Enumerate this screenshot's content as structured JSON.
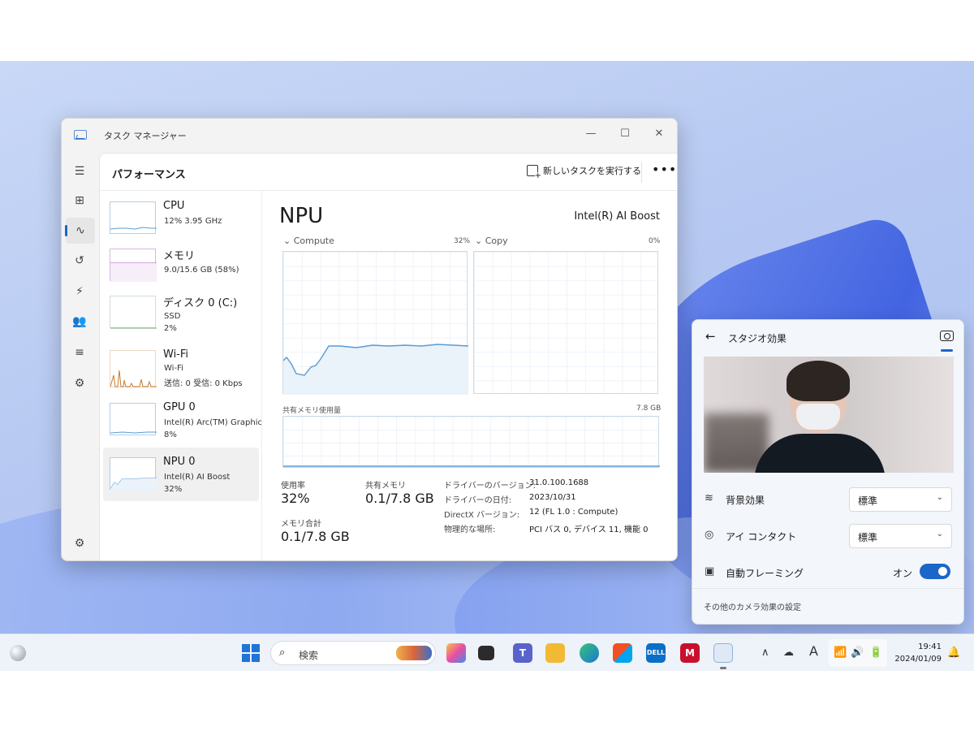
{
  "task_manager": {
    "title": "タスク マネージャー",
    "page_title": "パフォーマンス",
    "run_new_task": "新しいタスクを実行する",
    "more": "•••",
    "window": {
      "minimize": "—",
      "maximize": "☐",
      "close": "✕"
    },
    "devices": [
      {
        "name": "CPU",
        "line1": "12%  3.95 GHz",
        "line2": "",
        "line3": ""
      },
      {
        "name": "メモリ",
        "line1": "9.0/15.6 GB (58%)",
        "line2": "",
        "line3": ""
      },
      {
        "name": "ディスク 0 (C:)",
        "line1": "SSD",
        "line2": "2%",
        "line3": ""
      },
      {
        "name": "Wi-Fi",
        "line1": "Wi-Fi",
        "line2": "送信: 0  受信: 0 Kbps",
        "line3": ""
      },
      {
        "name": "GPU 0",
        "line1": "Intel(R) Arc(TM) Graphic",
        "line2": "8%",
        "line3": ""
      },
      {
        "name": "NPU 0",
        "line1": "Intel(R) AI Boost",
        "line2": "32%",
        "line3": ""
      }
    ],
    "detail": {
      "title": "NPU",
      "model": "Intel(R) AI Boost",
      "graph1": {
        "label": "Compute",
        "pct": "32%"
      },
      "graph2": {
        "label": "Copy",
        "pct": "0%"
      },
      "shared_mem_label": "共有メモリ使用量",
      "shared_mem_max": "7.8 GB",
      "usage_label": "使用率",
      "usage_value": "32%",
      "shared_label": "共有メモリ",
      "shared_value": "0.1/7.8 GB",
      "total_label": "メモリ合計",
      "total_value": "0.1/7.8 GB",
      "props": [
        {
          "k": "ドライバーのバージョン:",
          "v": "31.0.100.1688"
        },
        {
          "k": "ドライバーの日付:",
          "v": "2023/10/31"
        },
        {
          "k": "DirectX バージョン:",
          "v": "12 (FL 1.0 : Compute)"
        },
        {
          "k": "物理的な場所:",
          "v": "PCI バス 0, デバイス 11, 機能 0"
        }
      ]
    }
  },
  "studio": {
    "title": "スタジオ効果",
    "background_label": "背景効果",
    "background_value": "標準",
    "eye_label": "アイ コンタクト",
    "eye_value": "標準",
    "framing_label": "自動フレーミング",
    "framing_state": "オン",
    "footer": "その他のカメラ効果の設定"
  },
  "taskbar": {
    "search_placeholder": "検索",
    "time": "19:41",
    "date": "2024/01/09",
    "ime": "A"
  },
  "colors": {
    "accent": "#1b66c9",
    "graph_line": "#5a9bd3",
    "memory_line": "#b34fbf",
    "wifi_line": "#c87b2a"
  }
}
